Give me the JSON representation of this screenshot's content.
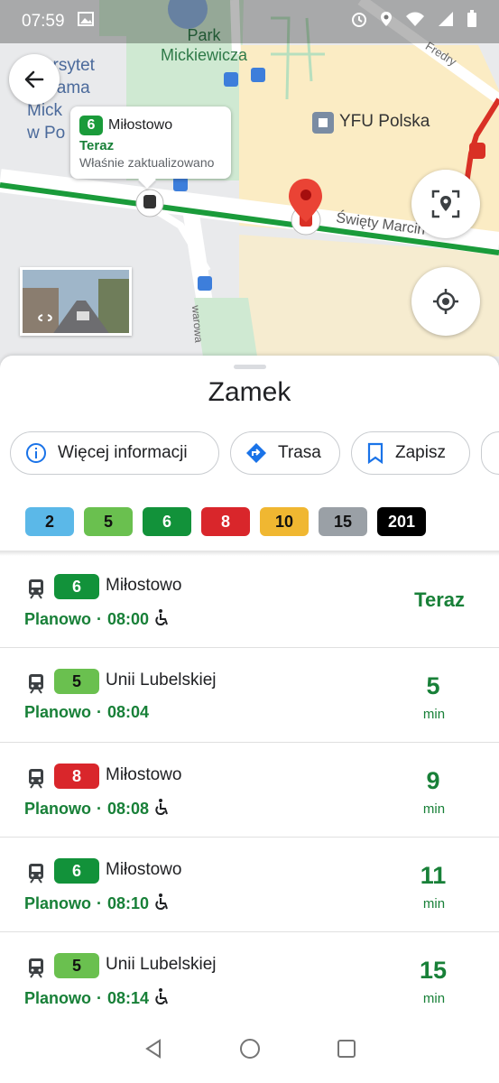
{
  "status_bar": {
    "time": "07:59"
  },
  "map": {
    "park_label_1": "Park",
    "park_label_2": "Mickiewicza",
    "university_label_1": "iwersytet",
    "university_label_2": ". Adama",
    "university_label_3": "Mick",
    "university_label_4": "w Po",
    "poi_label": "YFU Polska",
    "street_label": "Święty Marcin",
    "fredry_label": "Fredry",
    "warowa_label": "warowa"
  },
  "callout": {
    "line": "6",
    "destination": "Miłostowo",
    "status": "Teraz",
    "updated": "Właśnie zaktualizowano"
  },
  "stop": {
    "name": "Zamek"
  },
  "actions": {
    "info_label": "Więcej informacji",
    "route_label": "Trasa",
    "save_label": "Zapisz"
  },
  "lines": [
    {
      "label": "2",
      "bg": "#5bb8e8",
      "fg": "#111111"
    },
    {
      "label": "5",
      "bg": "#6ac04f",
      "fg": "#111111"
    },
    {
      "label": "6",
      "bg": "#12923a",
      "fg": "#ffffff"
    },
    {
      "label": "8",
      "bg": "#d9262b",
      "fg": "#ffffff"
    },
    {
      "label": "10",
      "bg": "#f0b731",
      "fg": "#111111"
    },
    {
      "label": "15",
      "bg": "#9aa0a6",
      "fg": "#111111"
    },
    {
      "label": "201",
      "bg": "#000000",
      "fg": "#ffffff"
    }
  ],
  "departures": [
    {
      "line": "6",
      "bg": "#12923a",
      "fg": "#ffffff",
      "destination": "Miłostowo",
      "scheduled_label": "Planowo",
      "separator": "·",
      "time": "08:00",
      "eta_text": "Teraz"
    },
    {
      "line": "5",
      "bg": "#6ac04f",
      "fg": "#111111",
      "destination": "Unii Lubelskiej",
      "scheduled_label": "Planowo",
      "separator": "·",
      "time": "08:04",
      "eta_num": "5",
      "eta_unit": "min"
    },
    {
      "line": "8",
      "bg": "#d9262b",
      "fg": "#ffffff",
      "destination": "Miłostowo",
      "scheduled_label": "Planowo",
      "separator": "·",
      "time": "08:08",
      "eta_num": "9",
      "eta_unit": "min"
    },
    {
      "line": "6",
      "bg": "#12923a",
      "fg": "#ffffff",
      "destination": "Miłostowo",
      "scheduled_label": "Planowo",
      "separator": "·",
      "time": "08:10",
      "eta_num": "11",
      "eta_unit": "min"
    },
    {
      "line": "5",
      "bg": "#6ac04f",
      "fg": "#111111",
      "destination": "Unii Lubelskiej",
      "scheduled_label": "Planowo",
      "separator": "·",
      "time": "08:14",
      "eta_num": "15",
      "eta_unit": "min"
    }
  ],
  "colors": {
    "accent_green": "#188038",
    "tram_line_green": "#1a9b3a",
    "pin_red": "#d93025",
    "link_blue": "#1a73e8"
  }
}
